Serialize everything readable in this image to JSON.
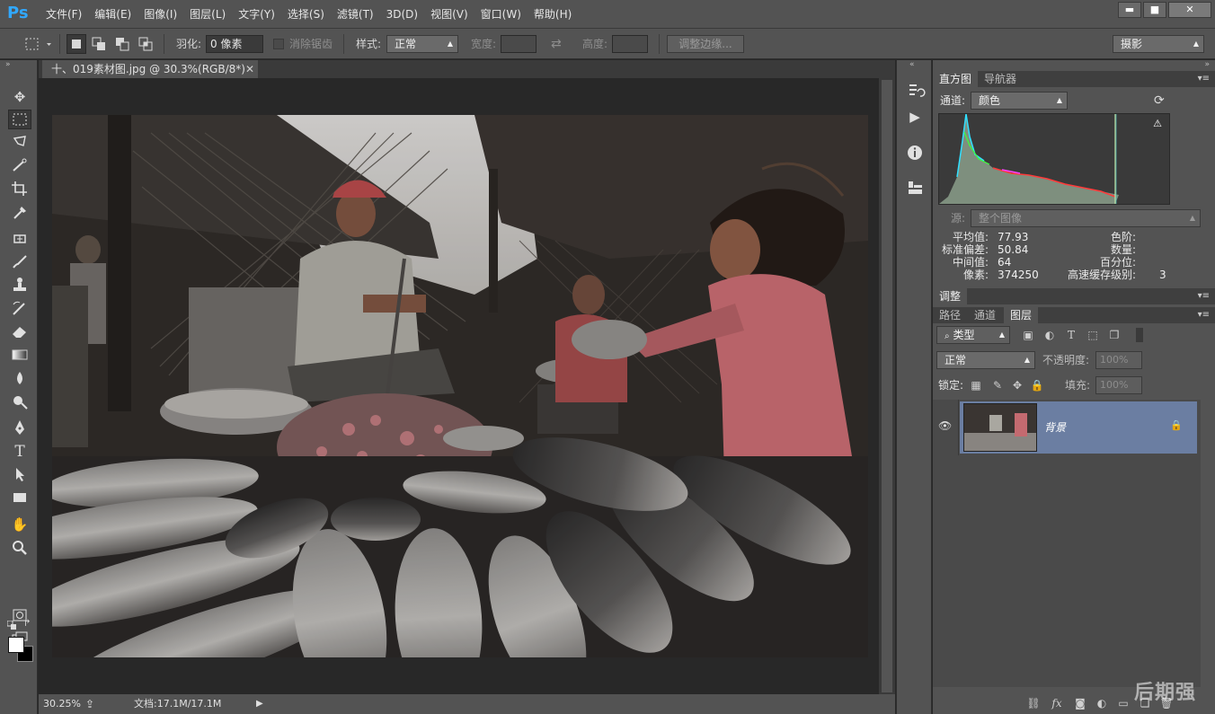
{
  "app": {
    "logo": "Ps"
  },
  "menu": [
    "文件(F)",
    "编辑(E)",
    "图像(I)",
    "图层(L)",
    "文字(Y)",
    "选择(S)",
    "滤镜(T)",
    "3D(D)",
    "视图(V)",
    "窗口(W)",
    "帮助(H)"
  ],
  "window_controls": {
    "minimize": "▬",
    "maximize": "■",
    "close": "✕"
  },
  "options": {
    "feather_label": "羽化:",
    "feather_value": "0 像素",
    "antialias_label": "消除锯齿",
    "style_label": "样式:",
    "style_value": "正常",
    "width_label": "宽度:",
    "height_label": "高度:",
    "refine_edge": "调整边缘...",
    "workspace": "摄影"
  },
  "document": {
    "tab_title": "十、019素材图.jpg @ 30.3%(RGB/8*)",
    "zoom": "30.25%",
    "doc_size": "文档:17.1M/17.1M"
  },
  "histogram": {
    "tabs": [
      "直方图",
      "导航器"
    ],
    "channel_label": "通道:",
    "channel_value": "颜色",
    "source_label": "源:",
    "source_value": "整个图像",
    "stats": [
      {
        "label": "平均值:",
        "value": "77.93"
      },
      {
        "label": "标准偏差:",
        "value": "50.84"
      },
      {
        "label": "中间值:",
        "value": "64"
      },
      {
        "label": "像素:",
        "value": "374250"
      }
    ],
    "stats_right": [
      {
        "label": "色阶:",
        "value": ""
      },
      {
        "label": "数量:",
        "value": ""
      },
      {
        "label": "百分位:",
        "value": ""
      },
      {
        "label": "高速缓存级别:",
        "value": "3"
      }
    ]
  },
  "adjustments": {
    "tab": "调整"
  },
  "layers": {
    "tabs": [
      "路径",
      "通道",
      "图层"
    ],
    "filter_kind": "类型",
    "blend_mode": "正常",
    "opacity_label": "不透明度:",
    "opacity_value": "100%",
    "lock_label": "锁定:",
    "fill_label": "填充:",
    "fill_value": "100%",
    "items": [
      {
        "name": "背景",
        "visible": true,
        "locked": true
      }
    ]
  },
  "watermark": "后期强",
  "icons": {
    "marquee": "marquee-icon",
    "move": "move-icon",
    "lasso": "lasso-icon",
    "quick_select": "quick-select-icon",
    "crop": "crop-icon",
    "eyedropper": "eyedropper-icon"
  }
}
